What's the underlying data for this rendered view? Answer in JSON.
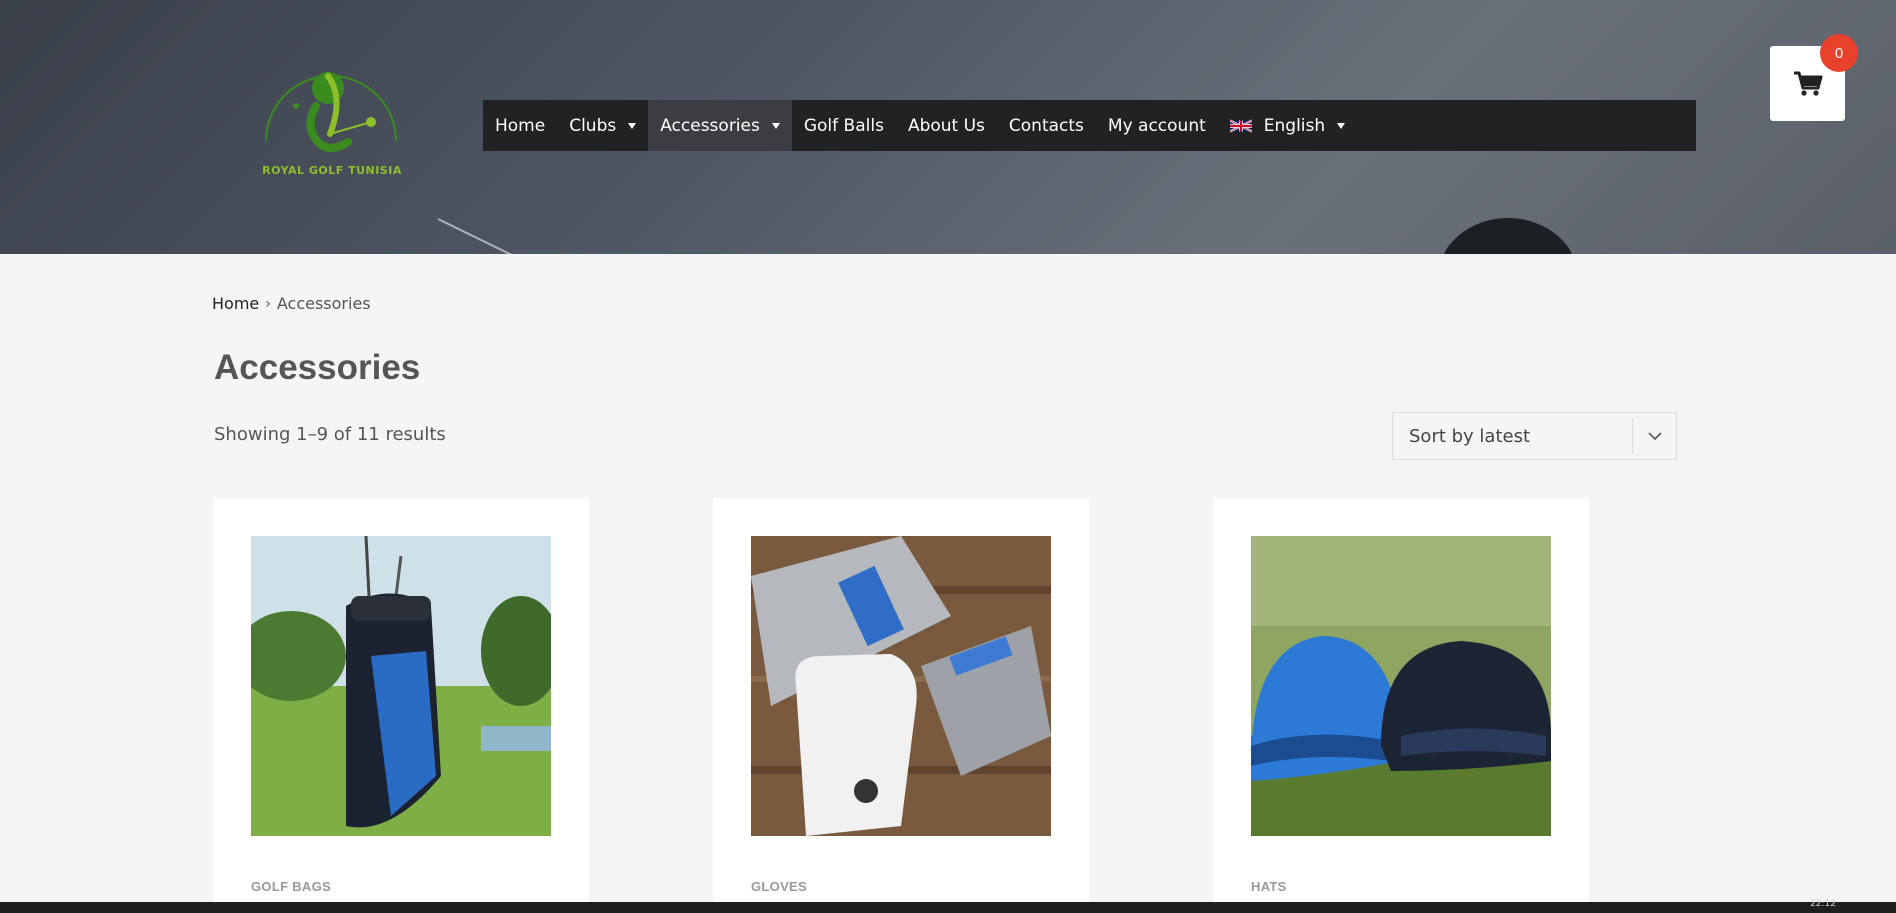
{
  "brand": {
    "logo_text": "ROYAL GOLF TUNISIA"
  },
  "nav": {
    "items": [
      {
        "label": "Home",
        "dropdown": false
      },
      {
        "label": "Clubs",
        "dropdown": true
      },
      {
        "label": "Accessories",
        "dropdown": true,
        "active": true
      },
      {
        "label": "Golf Balls",
        "dropdown": false
      },
      {
        "label": "About Us",
        "dropdown": false
      },
      {
        "label": "Contacts",
        "dropdown": false
      },
      {
        "label": "My account",
        "dropdown": false
      },
      {
        "label": "English",
        "dropdown": true,
        "icon": "uk-flag-icon"
      }
    ]
  },
  "cart": {
    "count": "0",
    "icon": "cart-icon"
  },
  "breadcrumb": {
    "home": "Home",
    "current": "Accessories"
  },
  "page": {
    "title": "Accessories",
    "results": "Showing 1–9 of 11 results"
  },
  "sort": {
    "selected": "Sort by latest"
  },
  "products": [
    {
      "category": "GOLF BAGS"
    },
    {
      "category": "GLOVES"
    },
    {
      "category": "HATS"
    }
  ],
  "colors": {
    "accent": "#e8412c",
    "nav_bg": "#222222",
    "logo_green": "#8cbf2a"
  },
  "taskbar": {
    "clock": "22:12"
  }
}
